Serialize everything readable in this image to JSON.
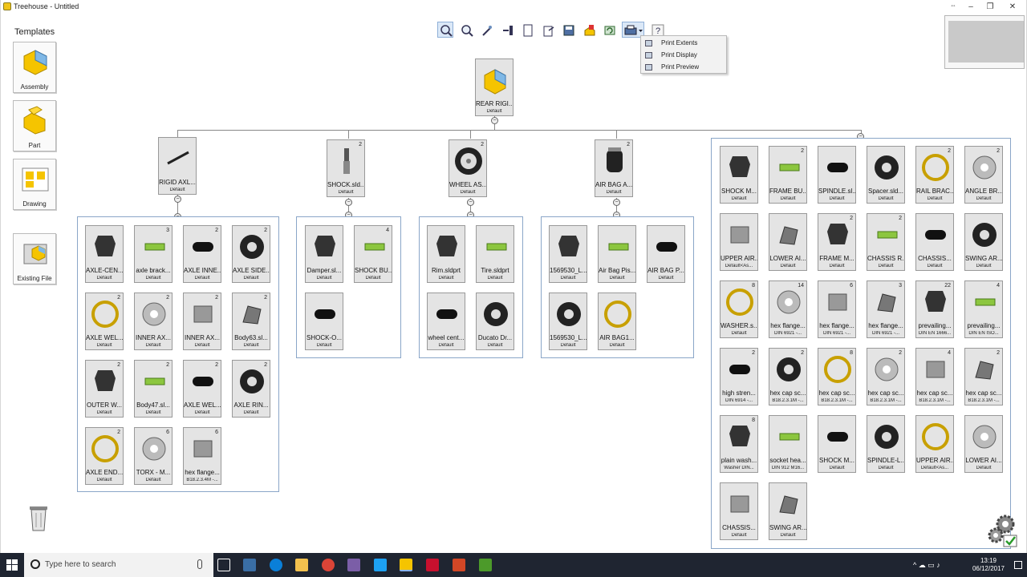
{
  "window": {
    "title": "Treehouse - Untitled"
  },
  "templates": {
    "title": "Templates",
    "items": [
      {
        "label": "Assembly",
        "icon": "assembly-icon"
      },
      {
        "label": "Part",
        "icon": "part-icon"
      },
      {
        "label": "Drawing",
        "icon": "drawing-icon"
      },
      {
        "label": "Existing File",
        "icon": "folder-icon"
      }
    ]
  },
  "print_menu": {
    "items": [
      "Print Extents",
      "Print Display",
      "Print Preview"
    ]
  },
  "tree": {
    "root": {
      "name": "REAR RIGI...",
      "config": "Default"
    },
    "subassemblies": [
      {
        "name": "RIGID AXL...",
        "config": "Default"
      },
      {
        "name": "SHOCK.sld...",
        "config": "Default",
        "count": "2"
      },
      {
        "name": "WHEEL AS...",
        "config": "Default",
        "count": "2"
      },
      {
        "name": "AIR BAG A...",
        "config": "Default",
        "count": "2"
      }
    ],
    "group1": [
      {
        "name": "AXLE-CEN...",
        "config": "Default",
        "count": ""
      },
      {
        "name": "axle brack...",
        "config": "Default",
        "count": "3"
      },
      {
        "name": "AXLE INNE...",
        "config": "Default",
        "count": "2"
      },
      {
        "name": "AXLE SIDE...",
        "config": "Default",
        "count": "2"
      },
      {
        "name": "AXLE WEL...",
        "config": "Default",
        "count": "2"
      },
      {
        "name": "INNER AX...",
        "config": "Default",
        "count": "2"
      },
      {
        "name": "INNER AX...",
        "config": "Default",
        "count": "2"
      },
      {
        "name": "Body63.sl...",
        "config": "Default",
        "count": "2"
      },
      {
        "name": "OUTER W...",
        "config": "Default",
        "count": "2"
      },
      {
        "name": "Body47.sl...",
        "config": "Default",
        "count": "2"
      },
      {
        "name": "AXLE WEL...",
        "config": "Default",
        "count": "2"
      },
      {
        "name": "AXLE RIN...",
        "config": "Default",
        "count": "2"
      },
      {
        "name": "AXLE END...",
        "config": "Default",
        "count": "2"
      },
      {
        "name": "TORX - M...",
        "config": "Default",
        "count": "6"
      },
      {
        "name": "hex flange...",
        "config": "B18.2.3.4M -...",
        "count": "6"
      }
    ],
    "group2": [
      {
        "name": "Damper.sl...",
        "config": "Default",
        "count": ""
      },
      {
        "name": "SHOCK BU...",
        "config": "Default",
        "count": "4"
      },
      {
        "name": "SHOCK-O...",
        "config": "Default",
        "count": ""
      }
    ],
    "group3": [
      {
        "name": "Rim.sldprt",
        "config": "Default",
        "count": ""
      },
      {
        "name": "Tire.sldprt",
        "config": "Default",
        "count": ""
      },
      {
        "name": "wheel cent...",
        "config": "Default",
        "count": ""
      },
      {
        "name": "Ducato Dr...",
        "config": "Default",
        "count": ""
      }
    ],
    "group4": [
      {
        "name": "1569530_L...",
        "config": "Default",
        "count": ""
      },
      {
        "name": "Air Bag Pis...",
        "config": "Default",
        "count": ""
      },
      {
        "name": "AIR BAG P...",
        "config": "Default",
        "count": ""
      },
      {
        "name": "1569530_L...",
        "config": "Default",
        "count": ""
      },
      {
        "name": "AIR BAG1...",
        "config": "Default",
        "count": ""
      }
    ],
    "group5": [
      {
        "name": "SHOCK M...",
        "config": "Default",
        "count": ""
      },
      {
        "name": "FRAME BU...",
        "config": "Default",
        "count": "2"
      },
      {
        "name": "SPINDLE.sl...",
        "config": "Default",
        "count": ""
      },
      {
        "name": "Spacer.sld...",
        "config": "Default",
        "count": ""
      },
      {
        "name": "RAIL BRAC...",
        "config": "Default",
        "count": "2"
      },
      {
        "name": "ANGLE BR...",
        "config": "Default",
        "count": "2"
      },
      {
        "name": "UPPER AIR...",
        "config": "Default<As...",
        "count": ""
      },
      {
        "name": "LOWER AI...",
        "config": "Default",
        "count": ""
      },
      {
        "name": "FRAME M...",
        "config": "Default",
        "count": "2"
      },
      {
        "name": "CHASSIS R...",
        "config": "Default",
        "count": "2"
      },
      {
        "name": "CHASSIS...",
        "config": "Default",
        "count": ""
      },
      {
        "name": "SWING AR...",
        "config": "Default",
        "count": ""
      },
      {
        "name": "WASHER.s...",
        "config": "Default",
        "count": "8"
      },
      {
        "name": "hex flange...",
        "config": "DIN 6921 -...",
        "count": "14"
      },
      {
        "name": "hex flange...",
        "config": "DIN 6921 -...",
        "count": "6"
      },
      {
        "name": "hex flange...",
        "config": "DIN 6921 -...",
        "count": "3"
      },
      {
        "name": "prevailing...",
        "config": "DIN EN 1666...",
        "count": "22"
      },
      {
        "name": "prevailing...",
        "config": "DIN EN ISO...",
        "count": "4"
      },
      {
        "name": "high stren...",
        "config": "DIN 6914 -...",
        "count": "2"
      },
      {
        "name": "hex cap sc...",
        "config": "B18.2.3.1M -...",
        "count": "2"
      },
      {
        "name": "hex cap sc...",
        "config": "B18.2.3.1M -...",
        "count": "8"
      },
      {
        "name": "hex cap sc...",
        "config": "B18.2.3.1M -...",
        "count": "2"
      },
      {
        "name": "hex cap sc...",
        "config": "B18.2.3.1M -...",
        "count": "4"
      },
      {
        "name": "hex cap sc...",
        "config": "B18.2.3.1M -...",
        "count": "2"
      },
      {
        "name": "plain wash...",
        "config": "Washer DIN...",
        "count": "8"
      },
      {
        "name": "socket hea...",
        "config": "DIN 912 M16...",
        "count": ""
      },
      {
        "name": "SHOCK M...",
        "config": "Default",
        "count": ""
      },
      {
        "name": "SPINDLE-L...",
        "config": "Default",
        "count": ""
      },
      {
        "name": "UPPER AIR...",
        "config": "Default<As...",
        "count": ""
      },
      {
        "name": "LOWER AI...",
        "config": "Default",
        "count": ""
      },
      {
        "name": "CHASSIS...",
        "config": "Default",
        "count": ""
      },
      {
        "name": "SWING AR...",
        "config": "Default",
        "count": ""
      }
    ]
  },
  "taskbar": {
    "search_placeholder": "Type here to search",
    "time": "13:19",
    "date": "06/12/2017"
  },
  "colors": {
    "accent": "#8aa6c8",
    "taskbar": "#1f2531"
  }
}
